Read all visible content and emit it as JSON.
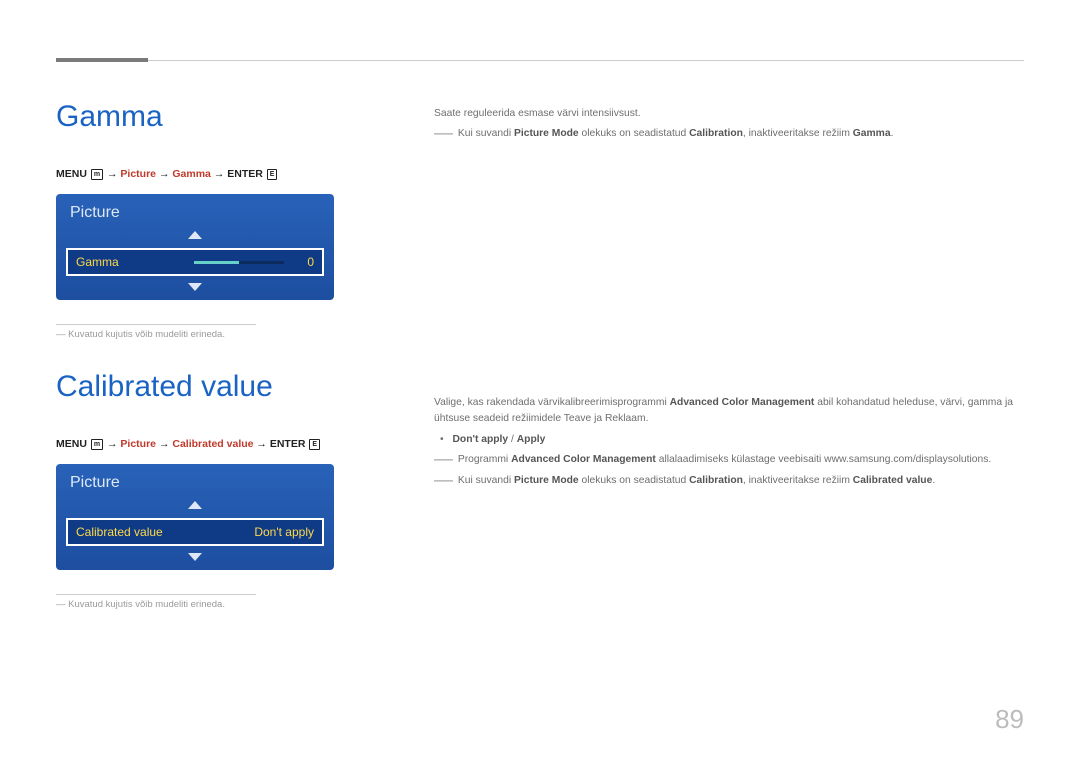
{
  "page_number": "89",
  "gamma": {
    "title": "Gamma",
    "menu_path": {
      "menu_label": "MENU",
      "arrow": " → ",
      "picture": "Picture",
      "page_name": "Gamma",
      "enter_label": "ENTER"
    },
    "osd": {
      "panel_title": "Picture",
      "item_label": "Gamma",
      "value": "0"
    },
    "caption_prefix": "― ",
    "caption": "Kuvatud kujutis võib mudeliti erineda.",
    "desc1": "Saate reguleerida esmase värvi intensiivsust.",
    "desc2_pre": "Kui suvandi ",
    "desc2_bold1": "Picture Mode",
    "desc2_mid": " olekuks on seadistatud ",
    "desc2_bold2": "Calibration",
    "desc2_post": ", inaktiveeritakse režiim ",
    "desc2_red": "Gamma",
    "desc2_end": "."
  },
  "calibrated": {
    "title": "Calibrated value",
    "menu_path": {
      "menu_label": "MENU",
      "arrow": " → ",
      "picture": "Picture",
      "page_name": "Calibrated value",
      "enter_label": "ENTER"
    },
    "osd": {
      "panel_title": "Picture",
      "item_label": "Calibrated value",
      "value": "Don't apply"
    },
    "caption_prefix": "― ",
    "caption": "Kuvatud kujutis võib mudeliti erineda.",
    "desc1_pre": "Valige, kas rakendada värvikalibreerimisprogrammi ",
    "desc1_bold": "Advanced Color Management",
    "desc1_post": " abil kohandatud heleduse, värvi, gamma ja ühtsuse seadeid režiimidele Teave ja Reklaam.",
    "options_dont": "Don't apply",
    "options_sep": " / ",
    "options_apply": "Apply",
    "note1_pre": "Programmi ",
    "note1_bold": "Advanced Color Management",
    "note1_post": " allalaadimiseks külastage veebisaiti www.samsung.com/displaysolutions.",
    "note2_pre": "Kui suvandi ",
    "note2_bold1": "Picture Mode",
    "note2_mid": " olekuks on seadistatud ",
    "note2_bold2": "Calibration",
    "note2_post": ", inaktiveeritakse režiim ",
    "note2_red": "Calibrated value",
    "note2_end": "."
  }
}
